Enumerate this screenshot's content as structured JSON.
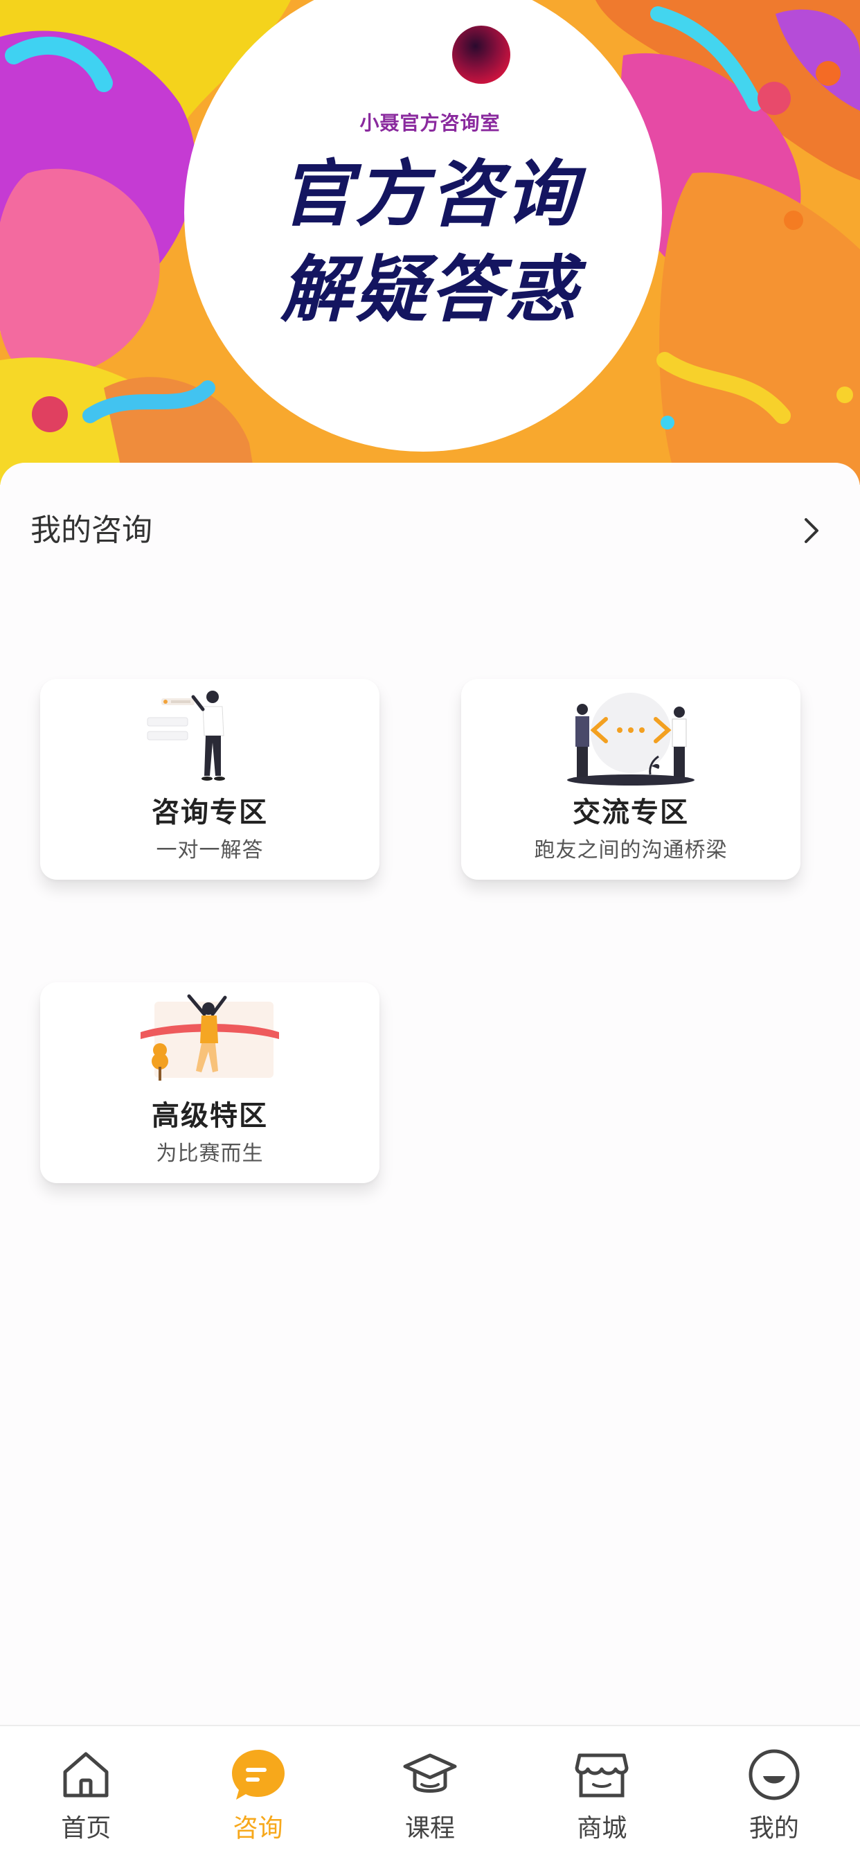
{
  "banner": {
    "subtitle": "小聂官方咨询室",
    "title_line1": "官方咨询",
    "title_line2": "解疑答惑"
  },
  "section": {
    "title": "我的咨询"
  },
  "cards": [
    {
      "title": "咨询专区",
      "subtitle": "一对一解答"
    },
    {
      "title": "交流专区",
      "subtitle": "跑友之间的沟通桥梁"
    },
    {
      "title": "高级特区",
      "subtitle": "为比赛而生"
    }
  ],
  "tabbar": {
    "active_color": "#f7a81b",
    "items": [
      {
        "label": "首页",
        "icon": "home-icon"
      },
      {
        "label": "咨询",
        "icon": "chat-bubble-icon",
        "active": true
      },
      {
        "label": "课程",
        "icon": "graduation-cap-icon"
      },
      {
        "label": "商城",
        "icon": "store-icon"
      },
      {
        "label": "我的",
        "icon": "smiley-face-icon"
      }
    ]
  }
}
